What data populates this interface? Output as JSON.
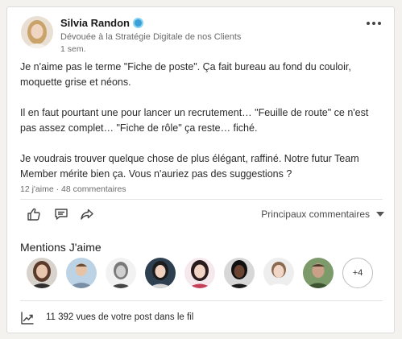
{
  "post": {
    "author": {
      "name": "Silvia Randon",
      "headline": "Dévouée à la Stratégie Digitale de nos Clients",
      "time": "1 sem."
    },
    "paragraphs": [
      "Je n'aime pas le terme \"Fiche de poste\". Ça fait bureau au fond du couloir, moquette grise et néons.",
      "Il en faut pourtant une pour lancer un recrutement… \"Feuille de route\" ce n'est pas assez complet… \"Fiche de rôle\" ça reste… fiché.",
      "Je voudrais trouver quelque chose de plus élégant, raffiné. Notre futur Team Member mérite bien ça. Vous n'auriez pas des suggestions ?"
    ],
    "stats": "12 j'aime · 48 commentaires"
  },
  "actions": {
    "icons": [
      "like-icon",
      "comment-icon",
      "share-icon"
    ],
    "sort_label": "Principaux commentaires"
  },
  "likes": {
    "title": "Mentions J'aime",
    "more_label": "+4"
  },
  "views": {
    "count": "11 392 vues",
    "suffix": " de votre post dans le fil"
  },
  "colors": {
    "verified_badge": "#3aa0d6",
    "background": "#f3f2ef",
    "card": "#ffffff"
  }
}
